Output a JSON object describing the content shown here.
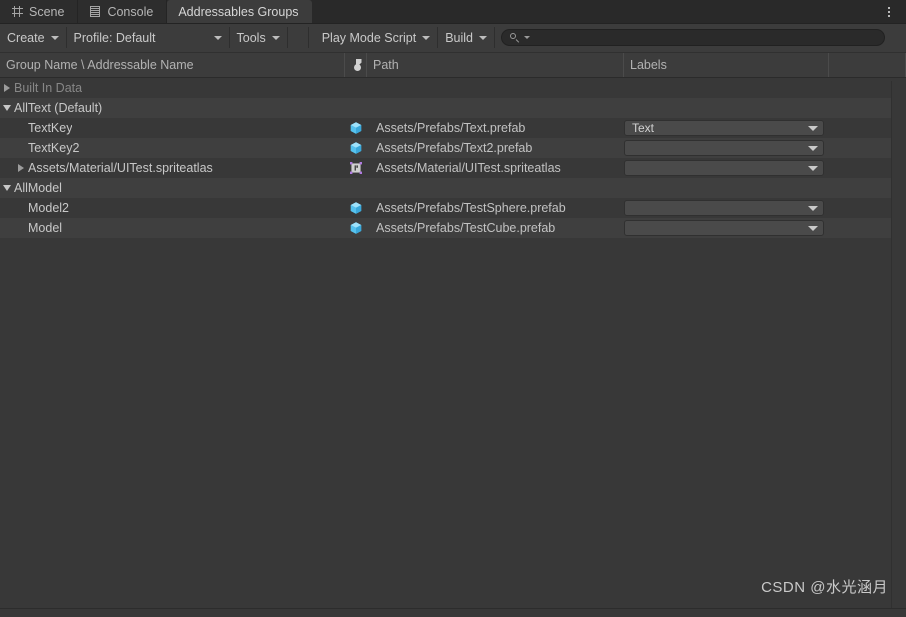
{
  "window": {
    "title": "Addressables Groups",
    "menu_icon": "kebab-menu-icon"
  },
  "tabs": [
    {
      "label": "Scene",
      "icon": "grid-icon",
      "active": false
    },
    {
      "label": "Console",
      "icon": "console-lines-icon",
      "active": false
    },
    {
      "label": "Addressables Groups",
      "icon": "",
      "active": true
    }
  ],
  "toolbar": {
    "create_label": "Create",
    "profile_label": "Profile: Default",
    "tools_label": "Tools",
    "play_mode_script_label": "Play Mode Script",
    "build_label": "Build",
    "search": {
      "value": "",
      "placeholder": "",
      "icon": "search-icon"
    }
  },
  "columns": [
    {
      "key": "name",
      "label": "Group Name \\ Addressable Name"
    },
    {
      "key": "icon",
      "label": "",
      "icon": "asset-type-icon"
    },
    {
      "key": "path",
      "label": "Path"
    },
    {
      "key": "labels",
      "label": "Labels"
    },
    {
      "key": "tail",
      "label": ""
    }
  ],
  "rows": [
    {
      "name": "Built In Data",
      "depth": 0,
      "foldout": "collapsed",
      "dimmed": true,
      "icon": "",
      "path": "",
      "label": null,
      "has_label_dropdown": false,
      "stripe": "odd"
    },
    {
      "name": "AllText (Default)",
      "depth": 0,
      "foldout": "expanded",
      "dimmed": false,
      "icon": "",
      "path": "",
      "label": null,
      "has_label_dropdown": false,
      "stripe": "even"
    },
    {
      "name": "TextKey",
      "depth": 1,
      "foldout": "none",
      "dimmed": false,
      "icon": "prefab-cube-icon",
      "path": "Assets/Prefabs/Text.prefab",
      "label": "Text",
      "has_label_dropdown": true,
      "stripe": "odd"
    },
    {
      "name": "TextKey2",
      "depth": 1,
      "foldout": "none",
      "dimmed": false,
      "icon": "prefab-cube-icon",
      "path": "Assets/Prefabs/Text2.prefab",
      "label": "",
      "has_label_dropdown": true,
      "stripe": "even"
    },
    {
      "name": "Assets/Material/UITest.spriteatlas",
      "depth": 1,
      "foldout": "collapsed",
      "dimmed": false,
      "icon": "sprite-atlas-icon",
      "path": "Assets/Material/UITest.spriteatlas",
      "label": "",
      "has_label_dropdown": true,
      "stripe": "odd"
    },
    {
      "name": "AllModel",
      "depth": 0,
      "foldout": "expanded",
      "dimmed": false,
      "icon": "",
      "path": "",
      "label": null,
      "has_label_dropdown": false,
      "stripe": "even"
    },
    {
      "name": "Model2",
      "depth": 1,
      "foldout": "none",
      "dimmed": false,
      "icon": "prefab-cube-icon",
      "path": "Assets/Prefabs/TestSphere.prefab",
      "label": "",
      "has_label_dropdown": true,
      "stripe": "odd"
    },
    {
      "name": "Model",
      "depth": 1,
      "foldout": "none",
      "dimmed": false,
      "icon": "prefab-cube-icon",
      "path": "Assets/Prefabs/TestCube.prefab",
      "label": "",
      "has_label_dropdown": true,
      "stripe": "even"
    }
  ],
  "watermark": {
    "text": "CSDN @水光涵月"
  },
  "colors": {
    "background": "#383838",
    "row_alt": "#3f3f3f",
    "toolbar": "#3c3c3c",
    "tabstrip": "#292929",
    "prefab_blue": "#5bc8f5",
    "atlas_purple": "#a77bd8",
    "text": "#c8c8c8",
    "text_dim": "#878787"
  }
}
